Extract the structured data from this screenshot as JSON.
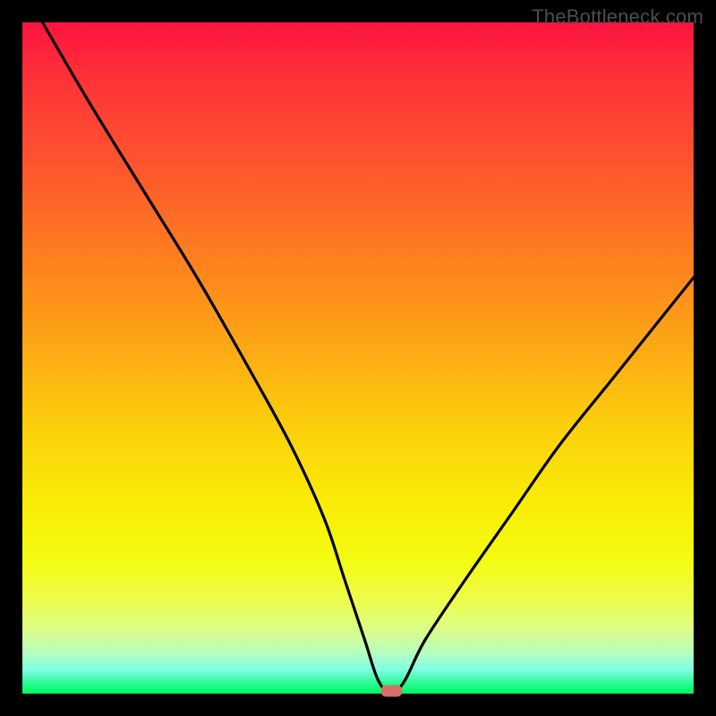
{
  "watermark": "TheBottleneck.com",
  "chart_data": {
    "type": "line",
    "title": "",
    "xlabel": "",
    "ylabel": "",
    "xlim": [
      0,
      100
    ],
    "ylim": [
      0,
      100
    ],
    "grid": false,
    "legend": false,
    "series": [
      {
        "name": "bottleneck-curve",
        "x": [
          3,
          10,
          18,
          26,
          34,
          40,
          45,
          48,
          51,
          53,
          55,
          57,
          60,
          66,
          73,
          80,
          88,
          96,
          100
        ],
        "y": [
          100,
          88,
          75,
          62,
          48,
          37,
          26,
          17,
          8,
          2,
          0,
          2,
          8,
          17,
          27,
          37,
          47,
          57,
          62
        ]
      }
    ],
    "annotations": [
      {
        "name": "minimum-marker",
        "x": 55,
        "y": 0
      }
    ],
    "background_gradient": {
      "direction": "vertical",
      "stops": [
        {
          "pos": 0.0,
          "color": "#fd1441"
        },
        {
          "pos": 0.35,
          "color": "#fe7f1f"
        },
        {
          "pos": 0.72,
          "color": "#f9ed07"
        },
        {
          "pos": 0.94,
          "color": "#b4fec0"
        },
        {
          "pos": 1.0,
          "color": "#00f95e"
        }
      ]
    }
  }
}
